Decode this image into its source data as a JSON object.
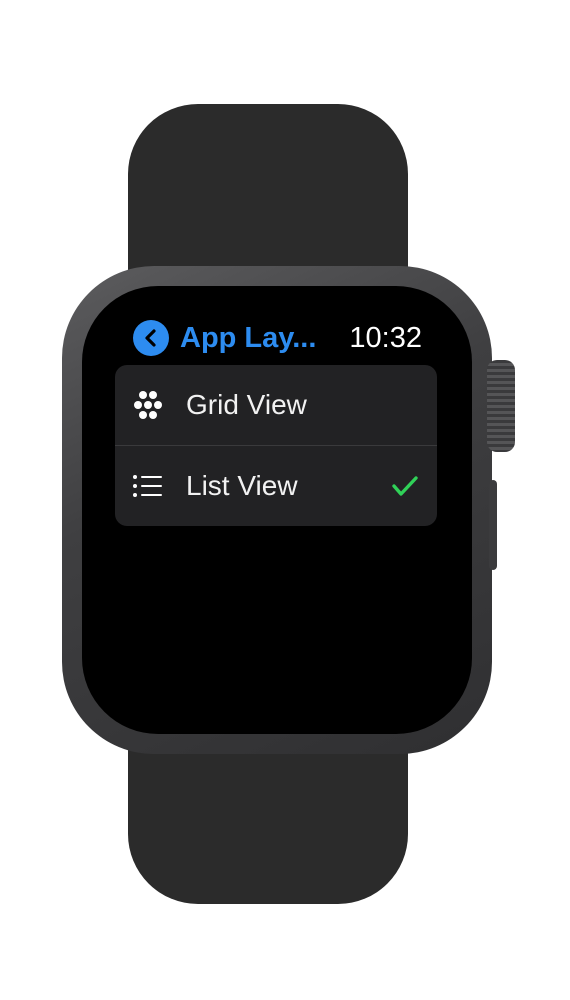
{
  "header": {
    "back_icon": "chevron-left-icon",
    "title": "App Lay...",
    "time": "10:32"
  },
  "options": [
    {
      "label": "Grid View",
      "icon": "grid-dots-icon",
      "selected": false
    },
    {
      "label": "List View",
      "icon": "list-icon",
      "selected": true
    }
  ],
  "colors": {
    "accent": "#2d8cf0",
    "checkmark": "#30d158",
    "row_background": "#222224"
  }
}
